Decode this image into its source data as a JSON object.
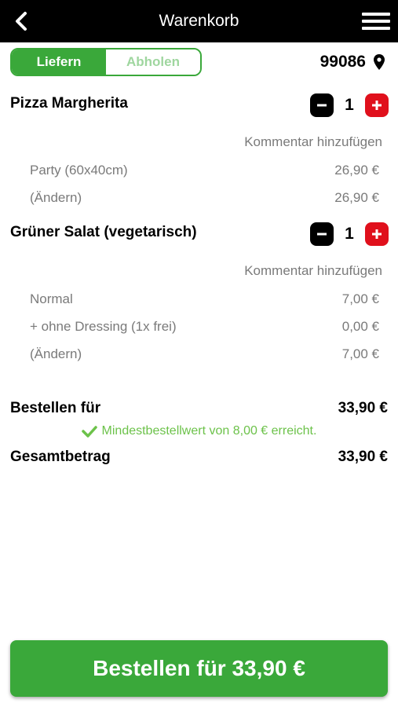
{
  "header": {
    "title": "Warenkorb",
    "back_icon": "chevron-left-icon",
    "menu_icon": "hamburger-menu-icon"
  },
  "delivery_toggle": {
    "options": [
      "Liefern",
      "Abholen"
    ],
    "selected": "Liefern"
  },
  "postal_code": {
    "value": "99086",
    "icon": "location-pin-icon"
  },
  "cart": {
    "items": [
      {
        "name": "Pizza Margherita",
        "quantity": "1",
        "comment_label": "Kommentar hinzufügen",
        "details": [
          {
            "label": "Party (60x40cm)",
            "price": "26,90 €"
          },
          {
            "label": "(Ändern)",
            "price": "26,90 €"
          }
        ]
      },
      {
        "name": "Grüner Salat (vegetarisch)",
        "quantity": "1",
        "comment_label": "Kommentar hinzufügen",
        "details": [
          {
            "label": "Normal",
            "price": "7,00 €"
          },
          {
            "label": "+ ohne Dressing (1x frei)",
            "price": "0,00 €"
          },
          {
            "label": "(Ändern)",
            "price": "7,00 €"
          }
        ]
      }
    ]
  },
  "summary": {
    "order_for_label": "Bestellen für",
    "order_for_value": "33,90 €",
    "min_order_note": "Mindestbestellwert von 8,00 € erreicht.",
    "total_label": "Gesamtbetrag",
    "total_value": "33,90 €"
  },
  "order_button": {
    "label": "Bestellen für 33,90 €"
  },
  "colors": {
    "header_bg": "#000000",
    "accent_green": "#3aa83a",
    "note_green": "#6cc24a",
    "plus_red": "#e0101c",
    "muted_text": "#7a7a7a"
  }
}
